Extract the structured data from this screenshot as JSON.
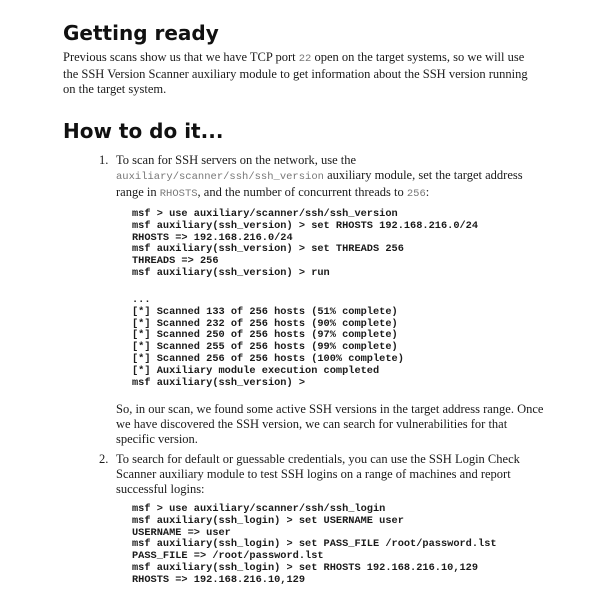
{
  "section1": {
    "heading": "Getting ready",
    "paragraph_part1": "Previous scans show us that we have TCP port ",
    "paragraph_port": "22",
    "paragraph_part2": " open on the target systems, so we will use the SSH Version Scanner auxiliary module to get information about the SSH version running on the target system."
  },
  "section2": {
    "heading": "How to do it...",
    "step1": {
      "number": "1.",
      "text_a": "To scan for SSH servers on the network, use the ",
      "module": "auxiliary/scanner/ssh/ssh_version",
      "text_b": " auxiliary module, set the target address range in ",
      "rhosts": "RHOSTS",
      "text_c": ", and the number of concurrent threads to ",
      "threads": "256",
      "text_d": ":",
      "code_block_1": [
        "msf > use auxiliary/scanner/ssh/ssh_version",
        "msf auxiliary(ssh_version) > set RHOSTS 192.168.216.0/24",
        "RHOSTS => 192.168.216.0/24",
        "msf auxiliary(ssh_version) > set THREADS 256",
        "THREADS => 256",
        "msf auxiliary(ssh_version) > run"
      ],
      "code_block_2": [
        "...",
        "[*] Scanned 133 of 256 hosts (51% complete)",
        "[*] Scanned 232 of 256 hosts (90% complete)",
        "[*] Scanned 250 of 256 hosts (97% complete)",
        "[*] Scanned 255 of 256 hosts (99% complete)",
        "[*] Scanned 256 of 256 hosts (100% complete)",
        "[*] Auxiliary module execution completed",
        "msf auxiliary(ssh_version) >"
      ],
      "after_text": "So, in our scan, we found some active SSH versions in the target address range. Once we have discovered the SSH version, we can search for vulnerabilities for that specific version."
    },
    "step2": {
      "number": "2.",
      "text": "To search for default or guessable credentials, you can use the SSH Login Check Scanner auxiliary module to test SSH logins on a range of machines and report successful logins:",
      "code_block": [
        "msf > use auxiliary/scanner/ssh/ssh_login",
        "msf auxiliary(ssh_login) > set USERNAME user",
        "USERNAME => user",
        "msf auxiliary(ssh_login) > set PASS_FILE /root/password.lst",
        "PASS_FILE => /root/password.lst",
        "msf auxiliary(ssh_login) > set RHOSTS 192.168.216.10,129",
        "RHOSTS => 192.168.216.10,129"
      ]
    }
  }
}
